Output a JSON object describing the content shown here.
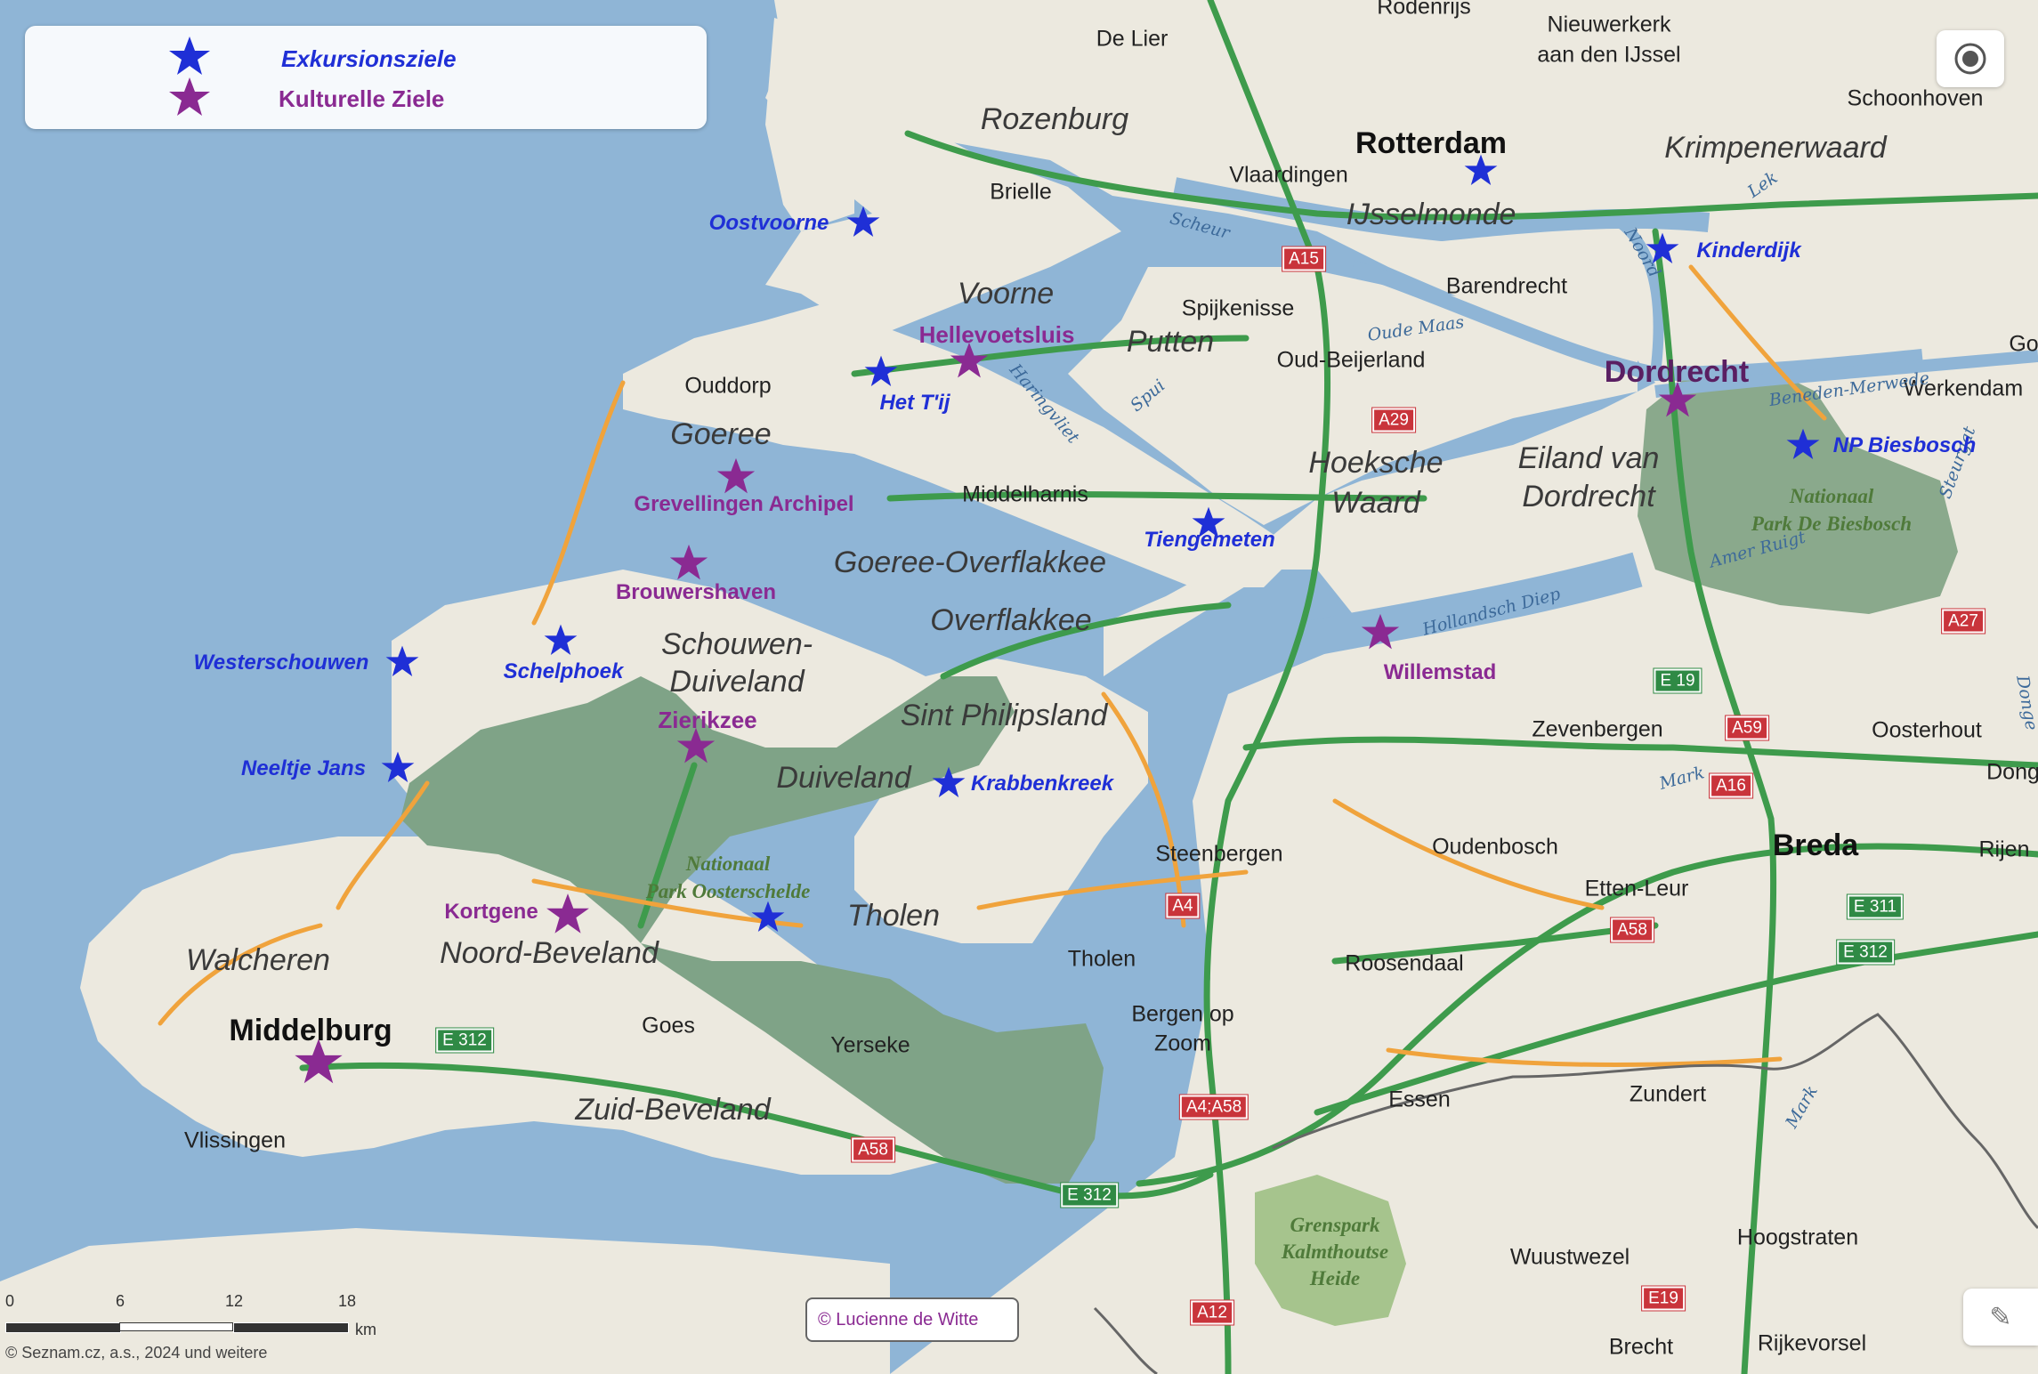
{
  "legend": {
    "items": [
      {
        "label": "Exkursionsziele",
        "color": "#1f2fd6",
        "icon": "star-icon"
      },
      {
        "label": "Kulturelle Ziele",
        "color": "#8a2a92",
        "icon": "star-icon"
      }
    ]
  },
  "regions": {
    "rozenburg": "Rozenburg",
    "voorne": "Voorne",
    "putten": "Putten",
    "ijsselmonde": "IJsselmonde",
    "krimpenerwaard": "Krimpenerwaard",
    "hoeksche_waard_1": "Hoeksche",
    "hoeksche_waard_2": "Waard",
    "eiland_1": "Eiland van",
    "eiland_2": "Dordrecht",
    "goeree": "Goeree",
    "goeree_overflakkee": "Goeree-Overflakkee",
    "overflakkee": "Overflakkee",
    "schouwen_1": "Schouwen-",
    "schouwen_2": "Duiveland",
    "sint_philipsland": "Sint Philipsland",
    "duiveland": "Duiveland",
    "tholen": "Tholen",
    "walcheren": "Walcheren",
    "noord_beveland": "Noord-Beveland",
    "zuid_beveland": "Zuid-Beveland"
  },
  "places": {
    "rodenrijs": "Rodenrijs",
    "de_lier": "De Lier",
    "nieuwerkerk_1": "Nieuwerkerk",
    "nieuwerkerk_2": "aan den IJssel",
    "schoonhoven": "Schoonhoven",
    "rotterdam": "Rotterdam",
    "vlaardingen": "Vlaardingen",
    "brielle": "Brielle",
    "barendrecht": "Barendrecht",
    "spijkenisse": "Spijkenisse",
    "oud_beijerland": "Oud-Beijerland",
    "dordrecht": "Dordrecht",
    "werkendam": "Werkendam",
    "go": "Go",
    "ouddorp": "Ouddorp",
    "middelharnis": "Middelharnis",
    "zevenbergen": "Zevenbergen",
    "oosterhout": "Oosterhout",
    "dong": "Dong",
    "steenbergen": "Steenbergen",
    "oudenbosch": "Oudenbosch",
    "breda": "Breda",
    "rijen": "Rijen",
    "etten_leur": "Etten-Leur",
    "tholen_town": "Tholen",
    "roosendaal": "Roosendaal",
    "bergen_1": "Bergen op",
    "bergen_2": "Zoom",
    "middelburg": "Middelburg",
    "goes": "Goes",
    "yerseke": "Yerseke",
    "vlissingen": "Vlissingen",
    "essen": "Essen",
    "zundert": "Zundert",
    "wuustwezel": "Wuustwezel",
    "hoogstraten": "Hoogstraten",
    "brecht": "Brecht",
    "rijkevorsel": "Rijkevorsel"
  },
  "waters": {
    "scheur": "Scheur",
    "oude_maas": "Oude Maas",
    "noord": "Noord",
    "lek": "Lek",
    "haringvliet": "Haringvliet",
    "spui": "Spui",
    "beneden_merwede": "Beneden-Merwede",
    "amer": "Amer Ruigt",
    "hollandsch_diep": "Hollandsch Diep",
    "mark": "Mark",
    "mark2": "Mark",
    "donge": "Donge",
    "steurgat": "Steurgat"
  },
  "parks": {
    "biesbosch_1": "Nationaal",
    "biesbosch_2": "Park De Biesbosch",
    "oosterschelde_1": "Nationaal",
    "oosterschelde_2": "Park Oosterschelde",
    "grenspark_1": "Grenspark",
    "grenspark_2": "Kalmthoutse",
    "grenspark_3": "Heide"
  },
  "roads": {
    "a15": "A15",
    "a29": "A29",
    "a27": "A27",
    "e19a": "E 19",
    "a59": "A59",
    "a16": "A16",
    "a4": "A4",
    "a58a": "A58",
    "e311": "E 311",
    "e312a": "E 312",
    "e312b": "E 312",
    "a4a58": "A4;A58",
    "e312c": "E 312",
    "a58b": "A58",
    "a12": "A12",
    "e19b": "E19"
  },
  "excursion_targets": {
    "oostvoorne": "Oostvoorne",
    "het_tij": "Het T'ij",
    "kinderdijk": "Kinderdijk",
    "np_biesbosch": "NP Biesbosch",
    "tiengemeten": "Tiengemeten",
    "westerschouwen": "Westerschouwen",
    "schelphoek": "Schelphoek",
    "neeltje_jans": "Neeltje Jans",
    "krabbenkreek": "Krabbenkreek"
  },
  "cultural_targets": {
    "hellevoetsluis": "Hellevoetsluis",
    "grevellingen": "Grevellingen Archipel",
    "brouwershaven": "Brouwershaven",
    "willemstad": "Willemstad",
    "zierikzee": "Zierikzee",
    "kortgene": "Kortgene"
  },
  "scale": {
    "ticks": [
      "0",
      "6",
      "12",
      "18"
    ],
    "unit": "km"
  },
  "attribution": "© Seznam.cz, a.s., 2024 und weitere",
  "copyright_box": "© Lucienne de Witte",
  "colors": {
    "excursion": "#1f2fd6",
    "cultural": "#8a2a92",
    "land": "#ece9df",
    "water": "#8fb5d6",
    "park": "#7fa387"
  }
}
